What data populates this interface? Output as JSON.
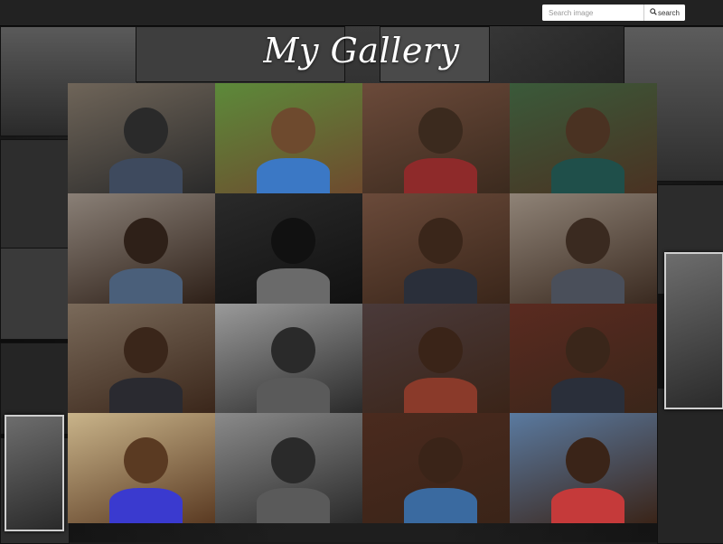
{
  "navbar": {
    "search": {
      "placeholder": "Search image",
      "button_label": "search",
      "button_icon": "search-icon"
    }
  },
  "header": {
    "title": "My Gallery"
  },
  "colors": {
    "navbar_bg": "#222222",
    "page_bg": "#1b1b1b",
    "title_text": "#ffffff"
  },
  "gallery": {
    "photos": [
      {
        "bg": "#6f6559",
        "accent": "#3e4a5e",
        "tone": "#2a2a2a"
      },
      {
        "bg": "#5c8a3a",
        "accent": "#3b78c5",
        "tone": "#6e4a2e"
      },
      {
        "bg": "#6b4a3a",
        "accent": "#8e2a2a",
        "tone": "#3b2a1e"
      },
      {
        "bg": "#3a5a3a",
        "accent": "#1f4f4a",
        "tone": "#4a3222"
      },
      {
        "bg": "#8a8077",
        "accent": "#4a5f7a",
        "tone": "#2e2018"
      },
      {
        "bg": "#2a2a2a",
        "accent": "#6a6a6a",
        "tone": "#111111"
      },
      {
        "bg": "#6a4a3a",
        "accent": "#2a2f3a",
        "tone": "#3a261a"
      },
      {
        "bg": "#8f8377",
        "accent": "#4a4f5a",
        "tone": "#3a2a20"
      },
      {
        "bg": "#7a6a5a",
        "accent": "#2a2a30",
        "tone": "#3a261a"
      },
      {
        "bg": "#9a9a9a",
        "accent": "#5a5a5a",
        "tone": "#2a2a2a"
      },
      {
        "bg": "#4a3a3a",
        "accent": "#8a3a2a",
        "tone": "#3a2418"
      },
      {
        "bg": "#5a2a20",
        "accent": "#2a2f3a",
        "tone": "#3a261a"
      },
      {
        "bg": "#c9b48a",
        "accent": "#3a3acf",
        "tone": "#5a3a22"
      },
      {
        "bg": "#8a8a8a",
        "accent": "#5a5a5a",
        "tone": "#2a2a2a"
      },
      {
        "bg": "#4a2a1e",
        "accent": "#3a6aa0",
        "tone": "#3a2418"
      },
      {
        "bg": "#5a7aa0",
        "accent": "#c53a3a",
        "tone": "#3a2418"
      }
    ]
  }
}
